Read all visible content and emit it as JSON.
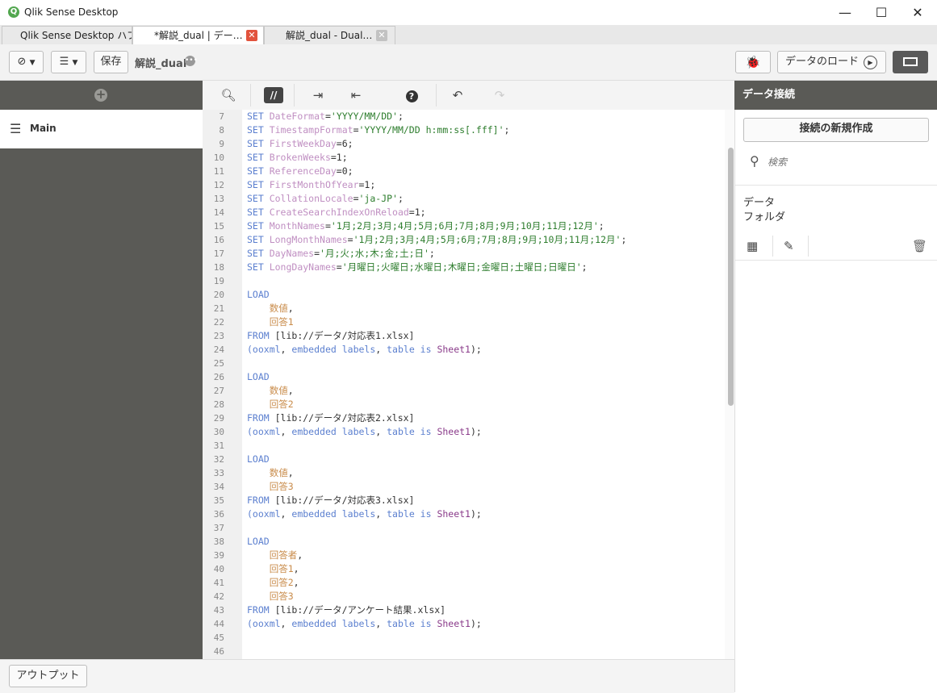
{
  "window": {
    "title": "Qlik Sense Desktop",
    "logo": "Q"
  },
  "tabs": [
    {
      "label": "Qlik Sense Desktop ハブ"
    },
    {
      "label": "*解説_dual | デー…"
    },
    {
      "label": "解説_dual - Dual…"
    }
  ],
  "toolbar": {
    "save_label": "保存",
    "app_name": "解説_dual",
    "load_label": "データのロード"
  },
  "left_panel": {
    "section_label": "Main"
  },
  "editor": {
    "lines": [
      {
        "n": "7",
        "s": [
          [
            "kw",
            "SET "
          ],
          [
            "var",
            "DateFormat"
          ],
          [
            "txt",
            "="
          ],
          [
            "str",
            "'YYYY/MM/DD'"
          ],
          [
            "txt",
            ";"
          ]
        ]
      },
      {
        "n": "8",
        "s": [
          [
            "kw",
            "SET "
          ],
          [
            "var",
            "TimestampFormat"
          ],
          [
            "txt",
            "="
          ],
          [
            "str",
            "'YYYY/MM/DD h:mm:ss[.fff]'"
          ],
          [
            "txt",
            ";"
          ]
        ]
      },
      {
        "n": "9",
        "s": [
          [
            "kw",
            "SET "
          ],
          [
            "var",
            "FirstWeekDay"
          ],
          [
            "txt",
            "=6;"
          ]
        ]
      },
      {
        "n": "10",
        "s": [
          [
            "kw",
            "SET "
          ],
          [
            "var",
            "BrokenWeeks"
          ],
          [
            "txt",
            "=1;"
          ]
        ]
      },
      {
        "n": "11",
        "s": [
          [
            "kw",
            "SET "
          ],
          [
            "var",
            "ReferenceDay"
          ],
          [
            "txt",
            "=0;"
          ]
        ]
      },
      {
        "n": "12",
        "s": [
          [
            "kw",
            "SET "
          ],
          [
            "var",
            "FirstMonthOfYear"
          ],
          [
            "txt",
            "=1;"
          ]
        ]
      },
      {
        "n": "13",
        "s": [
          [
            "kw",
            "SET "
          ],
          [
            "var",
            "CollationLocale"
          ],
          [
            "txt",
            "="
          ],
          [
            "str",
            "'ja-JP'"
          ],
          [
            "txt",
            ";"
          ]
        ]
      },
      {
        "n": "14",
        "s": [
          [
            "kw",
            "SET "
          ],
          [
            "var",
            "CreateSearchIndexOnReload"
          ],
          [
            "txt",
            "=1;"
          ]
        ]
      },
      {
        "n": "15",
        "s": [
          [
            "kw",
            "SET "
          ],
          [
            "var",
            "MonthNames"
          ],
          [
            "txt",
            "="
          ],
          [
            "str",
            "'1月;2月;3月;4月;5月;6月;7月;8月;9月;10月;11月;12月'"
          ],
          [
            "txt",
            ";"
          ]
        ]
      },
      {
        "n": "16",
        "s": [
          [
            "kw",
            "SET "
          ],
          [
            "var",
            "LongMonthNames"
          ],
          [
            "txt",
            "="
          ],
          [
            "str",
            "'1月;2月;3月;4月;5月;6月;7月;8月;9月;10月;11月;12月'"
          ],
          [
            "txt",
            ";"
          ]
        ]
      },
      {
        "n": "17",
        "s": [
          [
            "kw",
            "SET "
          ],
          [
            "var",
            "DayNames"
          ],
          [
            "txt",
            "="
          ],
          [
            "str",
            "'月;火;水;木;金;土;日'"
          ],
          [
            "txt",
            ";"
          ]
        ]
      },
      {
        "n": "18",
        "s": [
          [
            "kw",
            "SET "
          ],
          [
            "var",
            "LongDayNames"
          ],
          [
            "txt",
            "="
          ],
          [
            "str",
            "'月曜日;火曜日;水曜日;木曜日;金曜日;土曜日;日曜日'"
          ],
          [
            "txt",
            ";"
          ]
        ]
      },
      {
        "n": "19",
        "s": []
      },
      {
        "n": "20",
        "s": [
          [
            "kw",
            "LOAD"
          ]
        ]
      },
      {
        "n": "21",
        "s": [
          [
            "txt",
            "    "
          ],
          [
            "fld",
            "数値"
          ],
          [
            "txt",
            ","
          ]
        ]
      },
      {
        "n": "22",
        "s": [
          [
            "txt",
            "    "
          ],
          [
            "fld",
            "回答1"
          ]
        ]
      },
      {
        "n": "23",
        "s": [
          [
            "kw",
            "FROM "
          ],
          [
            "txt",
            "[lib://データ/対応表1.xlsx]"
          ]
        ]
      },
      {
        "n": "24",
        "s": [
          [
            "kw",
            "(ooxml"
          ],
          [
            "txt",
            ", "
          ],
          [
            "kw",
            "embedded labels"
          ],
          [
            "txt",
            ", "
          ],
          [
            "kw",
            "table is "
          ],
          [
            "tbl",
            "Sheet1"
          ],
          [
            "txt",
            ");"
          ]
        ]
      },
      {
        "n": "25",
        "s": []
      },
      {
        "n": "26",
        "s": [
          [
            "kw",
            "LOAD"
          ]
        ]
      },
      {
        "n": "27",
        "s": [
          [
            "txt",
            "    "
          ],
          [
            "fld",
            "数値"
          ],
          [
            "txt",
            ","
          ]
        ]
      },
      {
        "n": "28",
        "s": [
          [
            "txt",
            "    "
          ],
          [
            "fld",
            "回答2"
          ]
        ]
      },
      {
        "n": "29",
        "s": [
          [
            "kw",
            "FROM "
          ],
          [
            "txt",
            "[lib://データ/対応表2.xlsx]"
          ]
        ]
      },
      {
        "n": "30",
        "s": [
          [
            "kw",
            "(ooxml"
          ],
          [
            "txt",
            ", "
          ],
          [
            "kw",
            "embedded labels"
          ],
          [
            "txt",
            ", "
          ],
          [
            "kw",
            "table is "
          ],
          [
            "tbl",
            "Sheet1"
          ],
          [
            "txt",
            ");"
          ]
        ]
      },
      {
        "n": "31",
        "s": []
      },
      {
        "n": "32",
        "s": [
          [
            "kw",
            "LOAD"
          ]
        ]
      },
      {
        "n": "33",
        "s": [
          [
            "txt",
            "    "
          ],
          [
            "fld",
            "数値"
          ],
          [
            "txt",
            ","
          ]
        ]
      },
      {
        "n": "34",
        "s": [
          [
            "txt",
            "    "
          ],
          [
            "fld",
            "回答3"
          ]
        ]
      },
      {
        "n": "35",
        "s": [
          [
            "kw",
            "FROM "
          ],
          [
            "txt",
            "[lib://データ/対応表3.xlsx]"
          ]
        ]
      },
      {
        "n": "36",
        "s": [
          [
            "kw",
            "(ooxml"
          ],
          [
            "txt",
            ", "
          ],
          [
            "kw",
            "embedded labels"
          ],
          [
            "txt",
            ", "
          ],
          [
            "kw",
            "table is "
          ],
          [
            "tbl",
            "Sheet1"
          ],
          [
            "txt",
            ");"
          ]
        ]
      },
      {
        "n": "37",
        "s": []
      },
      {
        "n": "38",
        "s": [
          [
            "kw",
            "LOAD"
          ]
        ]
      },
      {
        "n": "39",
        "s": [
          [
            "txt",
            "    "
          ],
          [
            "fld",
            "回答者"
          ],
          [
            "txt",
            ","
          ]
        ]
      },
      {
        "n": "40",
        "s": [
          [
            "txt",
            "    "
          ],
          [
            "fld",
            "回答1"
          ],
          [
            "txt",
            ","
          ]
        ]
      },
      {
        "n": "41",
        "s": [
          [
            "txt",
            "    "
          ],
          [
            "fld",
            "回答2"
          ],
          [
            "txt",
            ","
          ]
        ]
      },
      {
        "n": "42",
        "s": [
          [
            "txt",
            "    "
          ],
          [
            "fld",
            "回答3"
          ]
        ]
      },
      {
        "n": "43",
        "s": [
          [
            "kw",
            "FROM "
          ],
          [
            "txt",
            "[lib://データ/アンケート結果.xlsx]"
          ]
        ]
      },
      {
        "n": "44",
        "s": [
          [
            "kw",
            "(ooxml"
          ],
          [
            "txt",
            ", "
          ],
          [
            "kw",
            "embedded labels"
          ],
          [
            "txt",
            ", "
          ],
          [
            "kw",
            "table is "
          ],
          [
            "tbl",
            "Sheet1"
          ],
          [
            "txt",
            ");"
          ]
        ]
      },
      {
        "n": "45",
        "s": []
      },
      {
        "n": "46",
        "s": []
      }
    ]
  },
  "right_panel": {
    "title": "データ接続",
    "new_connection_label": "接続の新規作成",
    "search_placeholder": "検索",
    "connection_name_line1": "データ",
    "connection_name_line2": "フォルダ"
  },
  "bottom": {
    "output_label": "アウトプット"
  }
}
